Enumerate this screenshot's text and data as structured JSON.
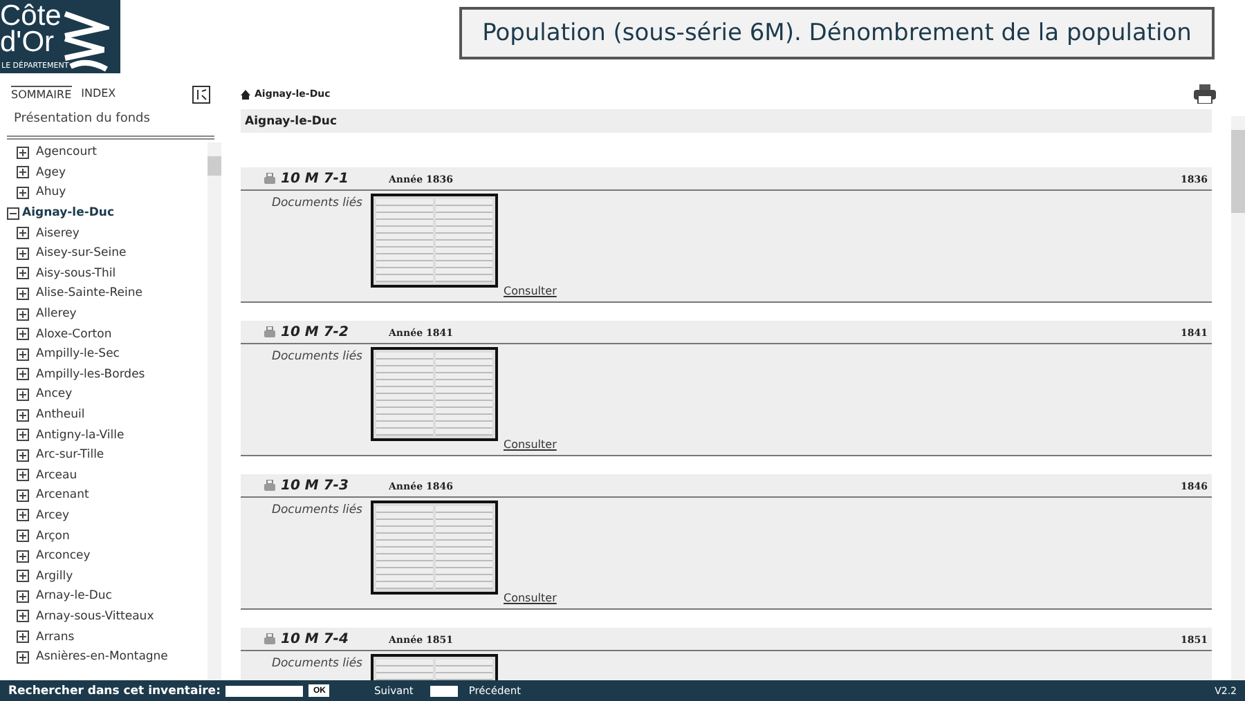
{
  "logo": {
    "line1": "Côte",
    "line2": "d'Or",
    "tagline": "LE DÉPARTEMENT"
  },
  "title": "Population (sous-série 6M). Dénombrement de la population",
  "sidebar": {
    "tabs": [
      {
        "label": "SOMMAIRE",
        "selected": true
      },
      {
        "label": "INDEX",
        "selected": false
      }
    ],
    "presentation": "Présentation du fonds",
    "items": [
      {
        "label": "Agencourt",
        "expanded": false,
        "selected": false
      },
      {
        "label": "Agey",
        "expanded": false,
        "selected": false
      },
      {
        "label": "Ahuy",
        "expanded": false,
        "selected": false
      },
      {
        "label": "Aignay-le-Duc",
        "expanded": true,
        "selected": true
      },
      {
        "label": "Aiserey",
        "expanded": false,
        "selected": false
      },
      {
        "label": "Aisey-sur-Seine",
        "expanded": false,
        "selected": false
      },
      {
        "label": "Aisy-sous-Thil",
        "expanded": false,
        "selected": false
      },
      {
        "label": "Alise-Sainte-Reine",
        "expanded": false,
        "selected": false
      },
      {
        "label": "Allerey",
        "expanded": false,
        "selected": false
      },
      {
        "label": "Aloxe-Corton",
        "expanded": false,
        "selected": false
      },
      {
        "label": "Ampilly-le-Sec",
        "expanded": false,
        "selected": false
      },
      {
        "label": "Ampilly-les-Bordes",
        "expanded": false,
        "selected": false
      },
      {
        "label": "Ancey",
        "expanded": false,
        "selected": false
      },
      {
        "label": "Antheuil",
        "expanded": false,
        "selected": false
      },
      {
        "label": "Antigny-la-Ville",
        "expanded": false,
        "selected": false
      },
      {
        "label": "Arc-sur-Tille",
        "expanded": false,
        "selected": false
      },
      {
        "label": "Arceau",
        "expanded": false,
        "selected": false
      },
      {
        "label": "Arcenant",
        "expanded": false,
        "selected": false
      },
      {
        "label": "Arcey",
        "expanded": false,
        "selected": false
      },
      {
        "label": "Arçon",
        "expanded": false,
        "selected": false
      },
      {
        "label": "Arconcey",
        "expanded": false,
        "selected": false
      },
      {
        "label": "Argilly",
        "expanded": false,
        "selected": false
      },
      {
        "label": "Arnay-le-Duc",
        "expanded": false,
        "selected": false
      },
      {
        "label": "Arnay-sous-Vitteaux",
        "expanded": false,
        "selected": false
      },
      {
        "label": "Arrans",
        "expanded": false,
        "selected": false
      },
      {
        "label": "Asnières-en-Montagne",
        "expanded": false,
        "selected": false
      }
    ]
  },
  "breadcrumb": "Aignay-le-Duc",
  "heading": "Aignay-le-Duc",
  "records": [
    {
      "code": "10 M 7-1",
      "year_label": "Année 1836",
      "year": "1836",
      "docs_label": "Documents liés",
      "link": "Consulter"
    },
    {
      "code": "10 M 7-2",
      "year_label": "Année 1841",
      "year": "1841",
      "docs_label": "Documents liés",
      "link": "Consulter"
    },
    {
      "code": "10 M 7-3",
      "year_label": "Année 1846",
      "year": "1846",
      "docs_label": "Documents liés",
      "link": "Consulter"
    },
    {
      "code": "10 M 7-4",
      "year_label": "Année 1851",
      "year": "1851",
      "docs_label": "Documents liés"
    }
  ],
  "footer": {
    "search_label": "Rechercher dans cet inventaire:",
    "ok": "OK",
    "next": "Suivant",
    "previous": "Précédent",
    "version": "V2.2"
  }
}
